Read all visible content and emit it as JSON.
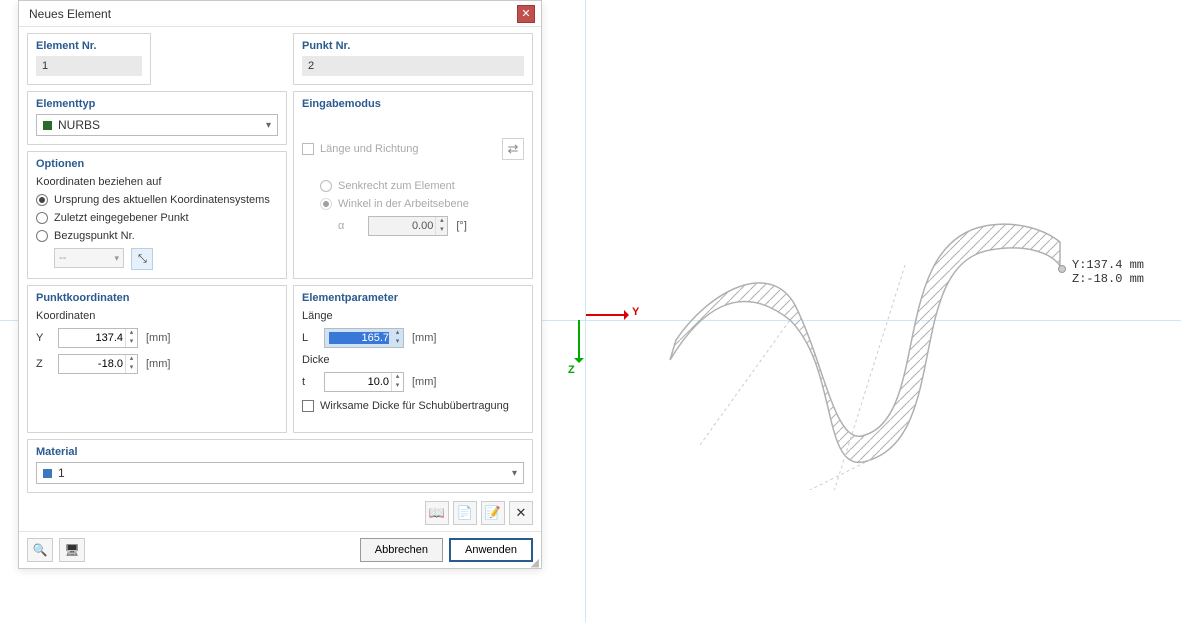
{
  "dialog": {
    "title": "Neues Element",
    "element_nr": {
      "legend": "Element Nr.",
      "value": "1"
    },
    "punkt_nr": {
      "legend": "Punkt Nr.",
      "value": "2"
    },
    "elementtyp": {
      "legend": "Elementtyp",
      "selected": "NURBS"
    },
    "optionen": {
      "legend": "Optionen",
      "coords_label": "Koordinaten beziehen auf",
      "opt_origin": "Ursprung des aktuellen Koordinatensystems",
      "opt_last": "Zuletzt eingegebener Punkt",
      "opt_ref": "Bezugspunkt Nr.",
      "ref_value": "--",
      "pick_icon": "⤡"
    },
    "eingabe": {
      "legend": "Eingabemodus",
      "length_dir": "Länge und Richtung",
      "perpendicular": "Senkrecht zum Element",
      "angle_plane": "Winkel in der Arbeitsebene",
      "alpha": "α",
      "alpha_value": "0.00",
      "alpha_unit": "[°]"
    },
    "punktkoord": {
      "legend": "Punktkoordinaten",
      "coords_label": "Koordinaten",
      "y_label": "Y",
      "y_value": "137.4",
      "z_label": "Z",
      "z_value": "-18.0",
      "unit": "[mm]"
    },
    "elementparam": {
      "legend": "Elementparameter",
      "length_label": "Länge",
      "l_label": "L",
      "l_value": "165.7",
      "thick_label": "Dicke",
      "t_label": "t",
      "t_value": "10.0",
      "unit": "[mm]",
      "eff_thick": "Wirksame Dicke für Schubübertragung"
    },
    "material": {
      "legend": "Material",
      "selected": "1"
    },
    "footer": {
      "cancel": "Abbrechen",
      "apply": "Anwenden"
    }
  },
  "viewport": {
    "axis_y": "Y",
    "axis_z": "Z",
    "coord_y": "Y:137.4 mm",
    "coord_z": "Z:-18.0 mm"
  }
}
